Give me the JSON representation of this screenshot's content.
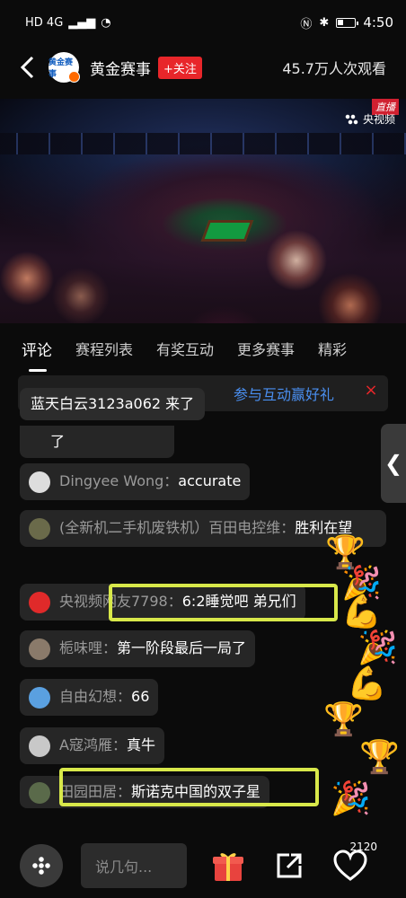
{
  "status_bar": {
    "left": "HD 4G",
    "time": "4:50"
  },
  "header": {
    "channel_name": "黄金赛事",
    "follow_label": "+关注",
    "views": "45.7万人次观看",
    "logo_text": "黄金赛事"
  },
  "video": {
    "live_badge": "直播",
    "watermark": "央视频"
  },
  "tabs": [
    {
      "label": "评论"
    },
    {
      "label": "赛程列表"
    },
    {
      "label": "有奖互动"
    },
    {
      "label": "更多赛事"
    },
    {
      "label": "精彩"
    }
  ],
  "promo": {
    "text": "参与互动赢好礼",
    "close": "×"
  },
  "side_tab": {
    "glyph": "❮"
  },
  "join_notice": {
    "text": "蓝天白云3123a062 来了"
  },
  "comments": [
    {
      "user": "",
      "text": "了"
    },
    {
      "user": "Dingyee Wong",
      "sep": "：",
      "text": "accurate"
    },
    {
      "user": "(全新机二手机废铁机）百田电控维",
      "sep": "：",
      "text": "胜利在望"
    },
    {
      "user": "央视频网友7798",
      "sep": "：",
      "text": "6:2睡觉吧 弟兄们"
    },
    {
      "user": "栀味哩",
      "sep": "：",
      "text": "第一阶段最后一局了"
    },
    {
      "user": "自由幻想",
      "sep": "：",
      "text": "66"
    },
    {
      "user": "A寇鸿雁",
      "sep": "：",
      "text": "真牛"
    },
    {
      "user": "田园田居",
      "sep": "：",
      "text": "斯诺克中国的双子星"
    }
  ],
  "bottom_bar": {
    "input_placeholder": "说几句...",
    "like_count": "2120"
  },
  "colors": {
    "accent_red": "#e8262a",
    "highlight": "#d8e84a",
    "link_blue": "#4a8ff0"
  }
}
